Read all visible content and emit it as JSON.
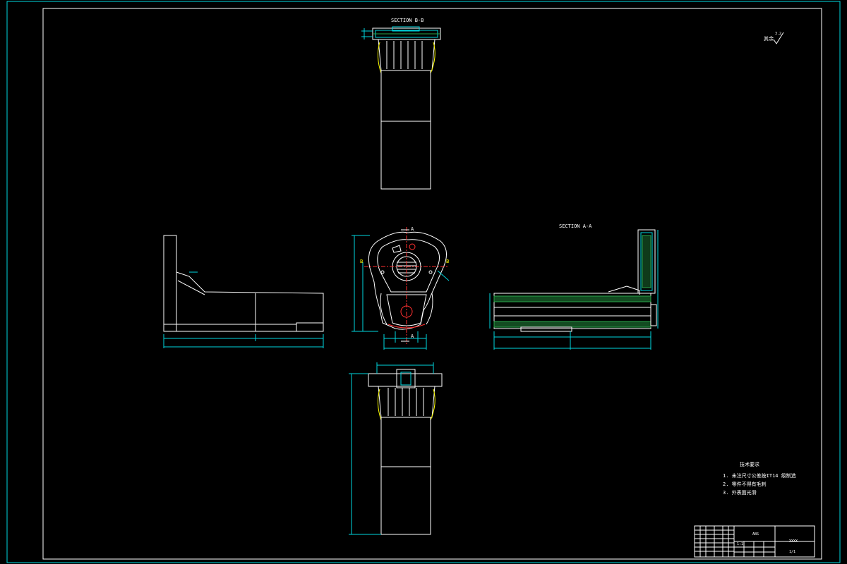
{
  "sections": {
    "section_b": "SECTION B-B",
    "section_a": "SECTION A-A"
  },
  "center_marks": {
    "a_top": "A",
    "a_bottom": "A",
    "b_left": "B",
    "b_right": "B"
  },
  "tech_notes": {
    "title": "技术要求",
    "items": [
      "1. 未注尺寸公差按IT14 级制造",
      "2. 零件不得有毛刺",
      "3. 外表面光滑"
    ]
  },
  "surface_finish": {
    "prefix": "其余",
    "value": "3.2"
  },
  "title_block": {
    "material": "ABS",
    "drawing_no": "XXXX",
    "scale": "1:1",
    "sheet": "1/1"
  },
  "colors": {
    "frame": "#00d8e0",
    "outline": "#ffffff",
    "text": "#ffff00",
    "hatch": "#2aa64a"
  }
}
